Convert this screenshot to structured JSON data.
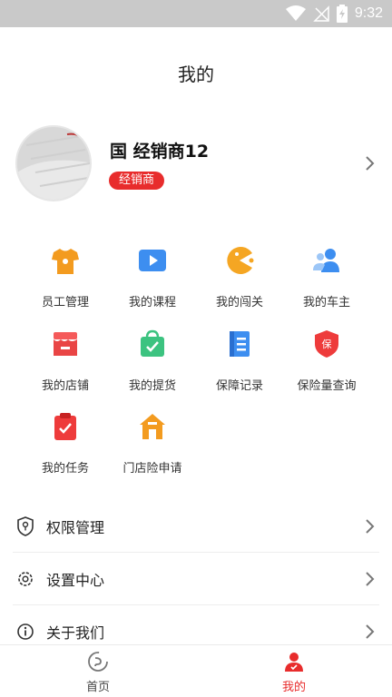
{
  "status_bar": {
    "time": "9:32"
  },
  "header": {
    "title": "我的"
  },
  "profile": {
    "name": "国 经销商12",
    "role": "经销商"
  },
  "grid": [
    {
      "label": "员工管理",
      "icon": "tshirt-icon"
    },
    {
      "label": "我的课程",
      "icon": "video-play-icon"
    },
    {
      "label": "我的闯关",
      "icon": "pacman-icon"
    },
    {
      "label": "我的车主",
      "icon": "users-icon"
    },
    {
      "label": "我的店铺",
      "icon": "store-icon"
    },
    {
      "label": "我的提货",
      "icon": "bag-check-icon"
    },
    {
      "label": "保障记录",
      "icon": "document-list-icon"
    },
    {
      "label": "保险量查询",
      "icon": "insurance-shield-icon"
    },
    {
      "label": "我的任务",
      "icon": "task-clipboard-icon"
    },
    {
      "label": "门店险申请",
      "icon": "house-icon"
    }
  ],
  "menu": [
    {
      "label": "权限管理",
      "icon": "permission-shield-icon"
    },
    {
      "label": "设置中心",
      "icon": "gear-icon"
    },
    {
      "label": "关于我们",
      "icon": "info-icon"
    }
  ],
  "tabs": [
    {
      "label": "首页",
      "active": false
    },
    {
      "label": "我的",
      "active": true
    }
  ],
  "colors": {
    "accent": "#e82c2c",
    "text_primary": "#222222",
    "text_secondary": "#333333",
    "status_bar": "#c9c9c9"
  }
}
